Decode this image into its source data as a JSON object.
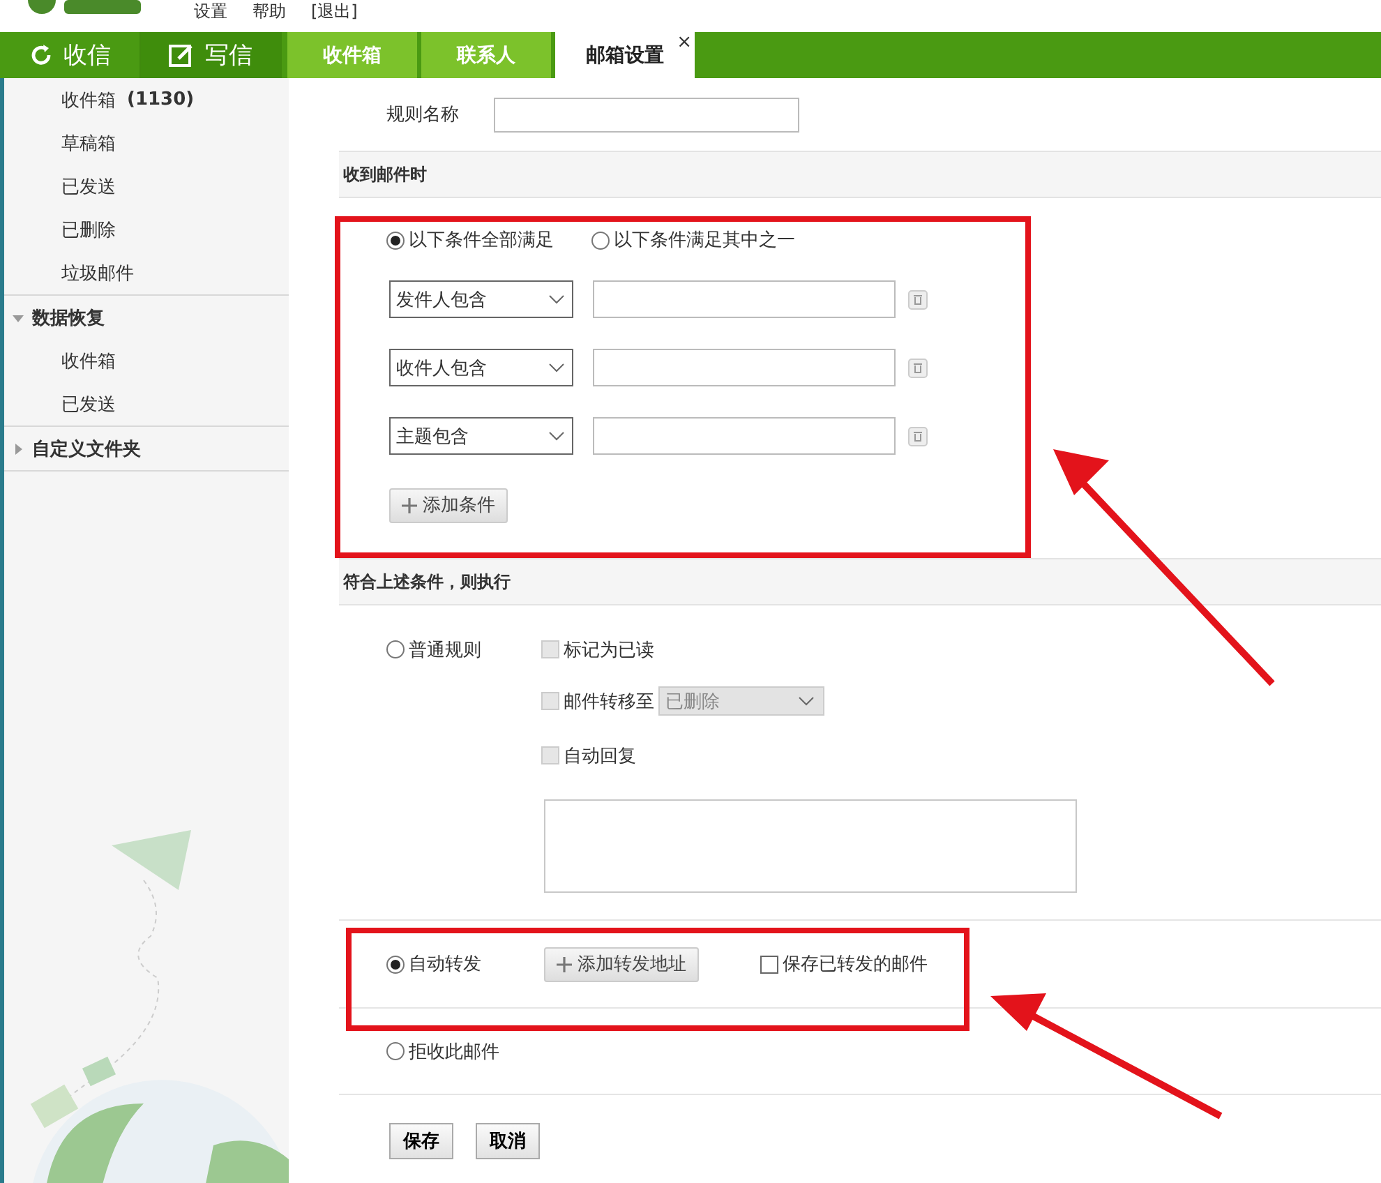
{
  "header": {
    "links": [
      "设置",
      "帮助",
      "[退出]"
    ]
  },
  "nav": {
    "actions": [
      {
        "kind": "refresh",
        "label": "收信"
      },
      {
        "kind": "compose",
        "label": "写信"
      }
    ],
    "tabs": [
      {
        "label": "收件箱",
        "selected": false
      },
      {
        "label": "联系人",
        "selected": false
      },
      {
        "label": "邮箱设置",
        "selected": true,
        "close": "×"
      }
    ]
  },
  "sidebar": {
    "items": [
      {
        "label": "收件箱",
        "count": "(1130)"
      },
      {
        "label": "草稿箱"
      },
      {
        "label": "已发送"
      },
      {
        "label": "已删除"
      },
      {
        "label": "垃圾邮件"
      }
    ],
    "groups": [
      {
        "label": "数据恢复",
        "expanded": true,
        "children": [
          {
            "label": "收件箱"
          },
          {
            "label": "已发送"
          }
        ]
      },
      {
        "label": "自定义文件夹",
        "expanded": false
      }
    ]
  },
  "rule_name": {
    "label": "规则名称"
  },
  "when": {
    "title": "收到邮件时",
    "match": [
      {
        "label": "以下条件全部满足",
        "selected": true
      },
      {
        "label": "以下条件满足其中之一",
        "selected": false
      }
    ],
    "conditions": [
      {
        "field": "发件人包含"
      },
      {
        "field": "收件人包含"
      },
      {
        "field": "主题包含"
      }
    ],
    "add_button": "添加条件"
  },
  "then": {
    "title": "符合上述条件，则执行",
    "normal": {
      "label": "普通规则",
      "selected": false,
      "options": [
        {
          "kind": "check",
          "label": "标记为已读",
          "checked": false,
          "disabled": true
        },
        {
          "kind": "move",
          "label": "邮件转移至",
          "checked": false,
          "disabled": true,
          "folder": "已删除"
        },
        {
          "kind": "check",
          "label": "自动回复",
          "checked": false,
          "disabled": true
        }
      ]
    },
    "forward": {
      "label": "自动转发",
      "selected": true,
      "add_button": "添加转发地址",
      "save_label": "保存已转发的邮件",
      "save_checked": false
    },
    "reject": {
      "label": "拒收此邮件",
      "selected": false
    }
  },
  "buttons": [
    "保存",
    "取消"
  ]
}
